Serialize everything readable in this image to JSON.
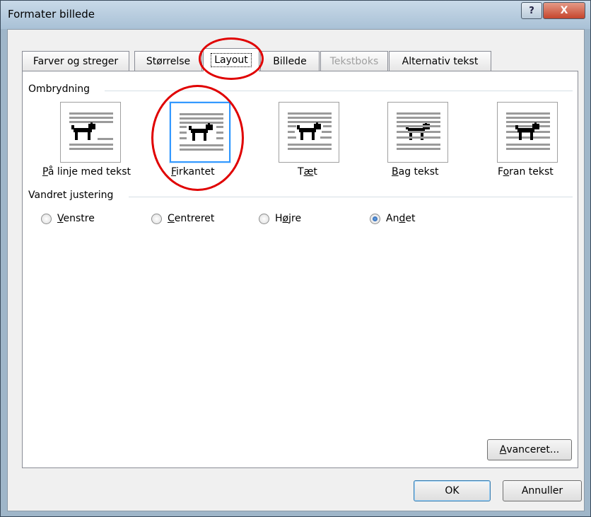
{
  "window": {
    "title": "Formater billede",
    "help_glyph": "?",
    "close_glyph": "X"
  },
  "tabs": [
    {
      "label": "Farver og streger",
      "state": "normal"
    },
    {
      "label": "Størrelse",
      "state": "normal"
    },
    {
      "label": "Layout",
      "state": "active"
    },
    {
      "label": "Billede",
      "state": "normal"
    },
    {
      "label": "Tekstboks",
      "state": "disabled"
    },
    {
      "label": "Alternativ tekst",
      "state": "normal"
    }
  ],
  "wrapping": {
    "section_label": "Ombrydning",
    "options": [
      {
        "pre": "",
        "key": "P",
        "post": "å linje med tekst",
        "icon": "inline-wrap-icon",
        "selected": false
      },
      {
        "pre": "",
        "key": "F",
        "post": "irkantet",
        "icon": "square-wrap-icon",
        "selected": true
      },
      {
        "pre": "T",
        "key": "æ",
        "post": "t",
        "icon": "tight-wrap-icon",
        "selected": false
      },
      {
        "pre": "",
        "key": "B",
        "post": "ag tekst",
        "icon": "behind-text-icon",
        "selected": false
      },
      {
        "pre": "F",
        "key": "o",
        "post": "ran tekst",
        "icon": "in-front-text-icon",
        "selected": false
      }
    ]
  },
  "alignment": {
    "section_label": "Vandret justering",
    "options": [
      {
        "pre": "",
        "key": "V",
        "post": "enstre",
        "checked": false
      },
      {
        "pre": "",
        "key": "C",
        "post": "entreret",
        "checked": false
      },
      {
        "pre": "H",
        "key": "ø",
        "post": "jre",
        "checked": false
      },
      {
        "pre": "An",
        "key": "d",
        "post": "et",
        "checked": true
      }
    ]
  },
  "buttons": {
    "advanced": {
      "key": "A",
      "post": "vanceret..."
    },
    "ok": "OK",
    "cancel": "Annuller"
  },
  "colors": {
    "selection": "#3399ff",
    "annotation": "#e00000"
  }
}
